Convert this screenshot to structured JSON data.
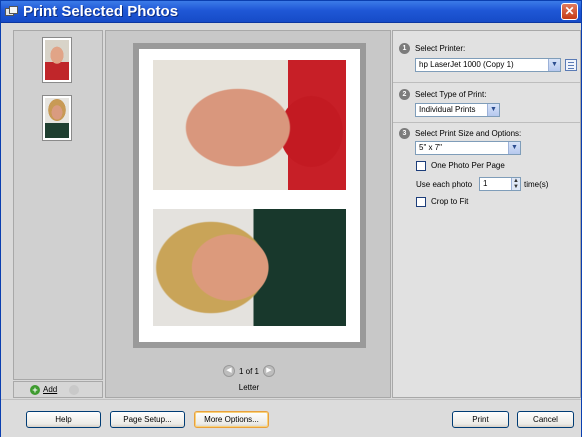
{
  "window": {
    "title": "Print Selected Photos",
    "close_glyph": "✕"
  },
  "sidebar": {
    "add_label": "Add",
    "add_glyph": "+"
  },
  "preview": {
    "page_indicator": "1 of 1",
    "paper_size": "Letter",
    "prev_glyph": "◀",
    "next_glyph": "▶"
  },
  "options": {
    "step1": {
      "number": "1",
      "label": "Select Printer:",
      "value": "hp LaserJet 1000 (Copy 1)"
    },
    "step2": {
      "number": "2",
      "label": "Select Type of Print:",
      "value": "Individual Prints"
    },
    "step3": {
      "number": "3",
      "label": "Select Print Size and Options:",
      "value": "5\" x 7\""
    },
    "one_photo_per_page": {
      "label": "One Photo Per Page",
      "checked": false
    },
    "use_each_photo": {
      "label": "Use each photo",
      "value": "1",
      "suffix": "time(s)"
    },
    "crop_to_fit": {
      "label": "Crop to Fit",
      "checked": false
    },
    "dropdown_glyph": "▼",
    "spin_up": "▲",
    "spin_down": "▼"
  },
  "footer": {
    "help": "Help",
    "page_setup": "Page Setup...",
    "more_options": "More Options...",
    "print": "Print",
    "cancel": "Cancel"
  },
  "colors": {
    "titlebar": "#1f57d6",
    "accent_button_border": "#e9a03c",
    "cursor": "#2fa52f"
  }
}
